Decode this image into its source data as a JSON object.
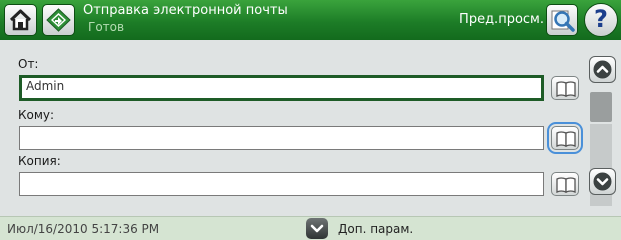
{
  "header": {
    "title": "Отправка электронной почты",
    "status": "Готов",
    "preview_label": "Пред.просм.",
    "help_glyph": "?"
  },
  "form": {
    "from": {
      "label": "От:",
      "value": "Admin"
    },
    "to": {
      "label": "Кому:",
      "value": ""
    },
    "cc": {
      "label": "Копия:",
      "value": ""
    }
  },
  "footer": {
    "datetime": "Июл/16/2010 5:17:36 PM",
    "more_options_label": "Доп. парам."
  },
  "icons": {
    "home": "home-icon",
    "app": "email-app-icon",
    "preview": "magnifier-icon",
    "address_book": "address-book-icon",
    "scroll_up": "chevron-up-icon",
    "scroll_down": "chevron-down-icon",
    "more": "chevron-down-icon"
  },
  "colors": {
    "header_green": "#1d7d27",
    "active_field_border": "#1e5c27",
    "focus_outline": "#4a90d9",
    "footer_bg": "#d5e4d2"
  }
}
